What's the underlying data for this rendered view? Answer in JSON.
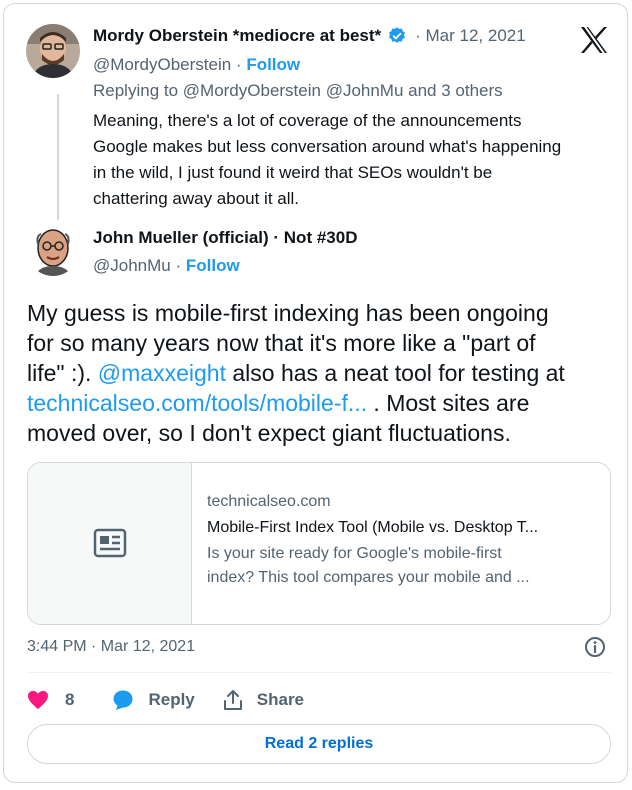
{
  "parent_tweet": {
    "author_name": "Mordy Oberstein *mediocre at best*",
    "separator_date": "· Mar 12, 2021",
    "handle": "@MordyOberstein",
    "handle_sep": " · ",
    "follow_label": "Follow",
    "replying_to": "Replying to @MordyOberstein @JohnMu and 3 others",
    "text_lines": [
      "Meaning, there's a lot of coverage of the announcements",
      "Google makes but less conversation around what's happening",
      "in the wild, I just found it weird that SEOs wouldn't be",
      "chattering away about it all."
    ]
  },
  "main_tweet": {
    "author_name": "John Mueller (official) · Not #30D",
    "handle": "@JohnMu",
    "handle_sep": " · ",
    "follow_label": "Follow",
    "line1": "My guess is mobile-first indexing has been ongoing",
    "line2": "for so many years now that it's more like a \"part of",
    "line3_pre": "life\" :). ",
    "line3_mention": "@maxxeight",
    "line3_post": " also has a neat tool for testing at",
    "line4_link": "technicalseo.com/tools/mobile-f...",
    "line4_post": " . Most sites are",
    "line5": "moved over, so I don't expect giant fluctuations."
  },
  "link_card": {
    "domain": "technicalseo.com",
    "title": "Mobile-First Index Tool (Mobile vs. Desktop T...",
    "desc_line1": "Is your site ready for Google's mobile-first",
    "desc_line2": "index? This tool compares your mobile and ..."
  },
  "footer": {
    "timestamp": "3:44 PM · Mar 12, 2021",
    "like_count": "8",
    "reply_label": "Reply",
    "share_label": "Share",
    "read_replies_label": "Read 2 replies"
  },
  "icons": {
    "brand": "x-logo-icon",
    "verified": "verified-badge-icon",
    "info": "info-icon",
    "like": "heart-icon",
    "reply": "reply-bubble-icon",
    "share": "share-icon",
    "article": "article-icon"
  },
  "colors": {
    "accent": "#1d9bf0",
    "like": "#f91880",
    "text": "#0f1419",
    "secondary": "#536471",
    "border": "#cfd9de"
  }
}
